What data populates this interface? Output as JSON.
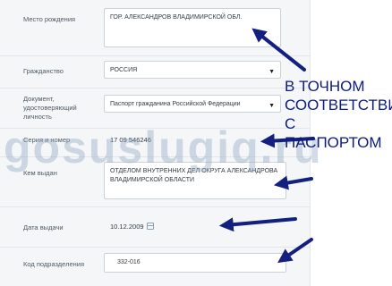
{
  "form": {
    "birthplace": {
      "label": "Место рождения",
      "value": "ГОР. АЛЕКСАНДРОВ ВЛАДИМИРСКОЙ ОБЛ."
    },
    "citizenship": {
      "label": "Гражданство",
      "value": "РОССИЯ"
    },
    "document": {
      "label": "Документ, удостоверяющий личность",
      "value": "Паспорт гражданина Российской Федерации"
    },
    "series": {
      "label": "Серия и номер",
      "value": "17 09 546246"
    },
    "issued_by": {
      "label": "Кем выдан",
      "value": "ОТДЕЛОМ ВНУТРЕННИХ ДЕЛ ОКРУГА АЛЕКСАНДРОВА ВЛАДИМИРСКОЙ ОБЛАСТИ"
    },
    "issue_date": {
      "label": "Дата выдачи",
      "value": "10.12.2009"
    },
    "subdivision": {
      "label": "Код подразделения",
      "value": "332-016"
    }
  },
  "annotation": "В ТОЧНОМ СООТВЕТСТВИИ С ПАСПОРТОМ",
  "watermark": "gosuslugiq.ru",
  "colors": {
    "arrow": "#13207f",
    "panel": "#f4f6f8"
  }
}
